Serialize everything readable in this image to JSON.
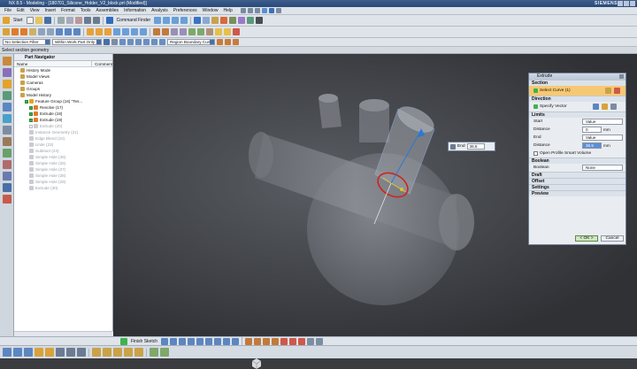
{
  "window": {
    "title": "NX 8.5 - Modeling - [180701_Silicone_Holder_V2_block.prt (Modified)]",
    "brand": "SIEMENS"
  },
  "menu": [
    "File",
    "Edit",
    "View",
    "Insert",
    "Format",
    "Tools",
    "Assemblies",
    "Information",
    "Analysis",
    "Preferences",
    "Window",
    "Help"
  ],
  "toolbar": {
    "start_label": "Start",
    "command_finder": "Command Finder"
  },
  "selection_bar": {
    "filter": "No Selection Filter",
    "scope": "Within Work Part Only",
    "curve_rule": "Region Boundary Curv"
  },
  "status": "Select section geometry",
  "navigator": {
    "title": "Part Navigator",
    "columns": [
      "Name",
      "Comment"
    ],
    "rows": [
      {
        "label": "History Mode",
        "indent": 1,
        "dim": false,
        "check": false
      },
      {
        "label": "Model Views",
        "indent": 1,
        "dim": false,
        "check": false
      },
      {
        "label": "Cameras",
        "indent": 1,
        "dim": false,
        "check": false
      },
      {
        "label": "Groups",
        "indent": 1,
        "dim": false,
        "check": false
      },
      {
        "label": "Model History",
        "indent": 1,
        "dim": false,
        "check": false
      },
      {
        "label": "Feature Group (16) \"Tes...",
        "indent": 2,
        "dim": false,
        "check": true
      },
      {
        "label": "Revolve (17)",
        "indent": 3,
        "dim": false,
        "check": true
      },
      {
        "label": "Extrude (18)",
        "indent": 3,
        "dim": false,
        "check": true
      },
      {
        "label": "Extrude (19)",
        "indent": 3,
        "dim": false,
        "check": true
      },
      {
        "label": "Extrude (20)",
        "indent": 3,
        "dim": true,
        "check": true
      },
      {
        "label": "Instance Geometry (21)",
        "indent": 3,
        "dim": true,
        "check": false
      },
      {
        "label": "Edge Blend (22)",
        "indent": 3,
        "dim": true,
        "check": false
      },
      {
        "label": "Unite (23)",
        "indent": 3,
        "dim": true,
        "check": false
      },
      {
        "label": "Subtract (24)",
        "indent": 3,
        "dim": true,
        "check": false
      },
      {
        "label": "Simple Hole (25)",
        "indent": 3,
        "dim": true,
        "check": false
      },
      {
        "label": "Simple Hole (26)",
        "indent": 3,
        "dim": true,
        "check": false
      },
      {
        "label": "Simple Hole (27)",
        "indent": 3,
        "dim": true,
        "check": false
      },
      {
        "label": "Simple Hole (28)",
        "indent": 3,
        "dim": true,
        "check": false
      },
      {
        "label": "Simple Hole (29)",
        "indent": 3,
        "dim": true,
        "check": false
      },
      {
        "label": "Extrude (30)",
        "indent": 3,
        "dim": true,
        "check": false
      }
    ]
  },
  "extrude": {
    "title": "Extrude",
    "section": {
      "header": "Section",
      "select_curve": "Select Curve (1)"
    },
    "direction": {
      "header": "Direction",
      "specify_vector": "Specify Vector"
    },
    "limits": {
      "header": "Limits",
      "start_label": "Start",
      "start_value": "Value",
      "distance1_label": "Distance",
      "distance1_value": "0",
      "distance1_unit": "mm",
      "end_label": "End",
      "end_value": "Value",
      "distance2_label": "Distance",
      "distance2_value": "36.5",
      "distance2_unit": "mm",
      "open_profile": "Open Profile Smart Volume"
    },
    "boolean": {
      "header": "Boolean",
      "label": "Boolean",
      "value": "None"
    },
    "collapsed": [
      "Draft",
      "Offset",
      "Settings",
      "Preview"
    ],
    "ok": "< OK >",
    "cancel": "Cancel"
  },
  "dynamic_input": {
    "label": "End",
    "value": "36.5"
  },
  "bottom_toolbar": {
    "sketch_label": "Finish Sketch"
  },
  "colors": {
    "accent": "#4a6fa5",
    "highlight": "#f7c873",
    "selection_red": "#d0241c",
    "axis_blue": "#2a78d6"
  }
}
